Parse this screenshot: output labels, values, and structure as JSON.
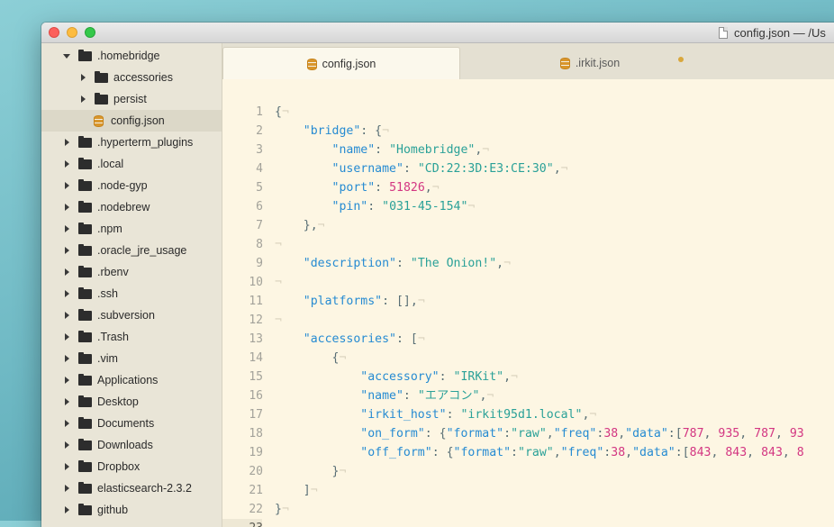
{
  "window": {
    "title": "config.json — /Us"
  },
  "sidebar": {
    "items": [
      {
        "label": ".homebridge",
        "type": "folder",
        "depth": 0,
        "expanded": true
      },
      {
        "label": "accessories",
        "type": "folder",
        "depth": 1,
        "expanded": false
      },
      {
        "label": "persist",
        "type": "folder",
        "depth": 1,
        "expanded": false
      },
      {
        "label": "config.json",
        "type": "file",
        "depth": 1,
        "selected": true
      },
      {
        "label": ".hyperterm_plugins",
        "type": "folder",
        "depth": 0,
        "expanded": false
      },
      {
        "label": ".local",
        "type": "folder",
        "depth": 0,
        "expanded": false
      },
      {
        "label": ".node-gyp",
        "type": "folder",
        "depth": 0,
        "expanded": false
      },
      {
        "label": ".nodebrew",
        "type": "folder",
        "depth": 0,
        "expanded": false
      },
      {
        "label": ".npm",
        "type": "folder",
        "depth": 0,
        "expanded": false
      },
      {
        "label": ".oracle_jre_usage",
        "type": "folder",
        "depth": 0,
        "expanded": false
      },
      {
        "label": ".rbenv",
        "type": "folder",
        "depth": 0,
        "expanded": false
      },
      {
        "label": ".ssh",
        "type": "folder",
        "depth": 0,
        "expanded": false
      },
      {
        "label": ".subversion",
        "type": "folder",
        "depth": 0,
        "expanded": false
      },
      {
        "label": ".Trash",
        "type": "folder",
        "depth": 0,
        "expanded": false
      },
      {
        "label": ".vim",
        "type": "folder",
        "depth": 0,
        "expanded": false
      },
      {
        "label": "Applications",
        "type": "folder",
        "depth": 0,
        "expanded": false
      },
      {
        "label": "Desktop",
        "type": "folder",
        "depth": 0,
        "expanded": false
      },
      {
        "label": "Documents",
        "type": "folder",
        "depth": 0,
        "expanded": false
      },
      {
        "label": "Downloads",
        "type": "folder",
        "depth": 0,
        "expanded": false
      },
      {
        "label": "Dropbox",
        "type": "folder",
        "depth": 0,
        "expanded": false
      },
      {
        "label": "elasticsearch-2.3.2",
        "type": "folder",
        "depth": 0,
        "expanded": false
      },
      {
        "label": "github",
        "type": "folder",
        "depth": 0,
        "expanded": false
      }
    ]
  },
  "tabs": [
    {
      "label": "config.json",
      "active": true,
      "icon": "database-icon"
    },
    {
      "label": ".irkit.json",
      "active": false,
      "icon": "database-icon",
      "dirty": true
    }
  ],
  "editor": {
    "current_line": 23,
    "colors": {
      "key": "#268bd2",
      "string": "#2aa198",
      "number": "#d33682",
      "punct": "#586e75",
      "background": "#fdf6e3"
    },
    "lines": [
      [
        [
          "p",
          "{"
        ]
      ],
      [
        [
          "p",
          "    "
        ],
        [
          "k",
          "\"bridge\""
        ],
        [
          "p",
          ": {"
        ]
      ],
      [
        [
          "p",
          "        "
        ],
        [
          "k",
          "\"name\""
        ],
        [
          "p",
          ": "
        ],
        [
          "s",
          "\"Homebridge\""
        ],
        [
          "p",
          ","
        ]
      ],
      [
        [
          "p",
          "        "
        ],
        [
          "k",
          "\"username\""
        ],
        [
          "p",
          ": "
        ],
        [
          "s",
          "\"CD:22:3D:E3:CE:30\""
        ],
        [
          "p",
          ","
        ]
      ],
      [
        [
          "p",
          "        "
        ],
        [
          "k",
          "\"port\""
        ],
        [
          "p",
          ": "
        ],
        [
          "n",
          "51826"
        ],
        [
          "p",
          ","
        ]
      ],
      [
        [
          "p",
          "        "
        ],
        [
          "k",
          "\"pin\""
        ],
        [
          "p",
          ": "
        ],
        [
          "s",
          "\"031-45-154\""
        ]
      ],
      [
        [
          "p",
          "    },"
        ]
      ],
      [],
      [
        [
          "p",
          "    "
        ],
        [
          "k",
          "\"description\""
        ],
        [
          "p",
          ": "
        ],
        [
          "s",
          "\"The Onion!\""
        ],
        [
          "p",
          ","
        ]
      ],
      [],
      [
        [
          "p",
          "    "
        ],
        [
          "k",
          "\"platforms\""
        ],
        [
          "p",
          ": [],"
        ]
      ],
      [],
      [
        [
          "p",
          "    "
        ],
        [
          "k",
          "\"accessories\""
        ],
        [
          "p",
          ": ["
        ]
      ],
      [
        [
          "p",
          "        {"
        ]
      ],
      [
        [
          "p",
          "            "
        ],
        [
          "k",
          "\"accessory\""
        ],
        [
          "p",
          ": "
        ],
        [
          "s",
          "\"IRKit\""
        ],
        [
          "p",
          ","
        ]
      ],
      [
        [
          "p",
          "            "
        ],
        [
          "k",
          "\"name\""
        ],
        [
          "p",
          ": "
        ],
        [
          "s",
          "\"エアコン\""
        ],
        [
          "p",
          ","
        ]
      ],
      [
        [
          "p",
          "            "
        ],
        [
          "k",
          "\"irkit_host\""
        ],
        [
          "p",
          ": "
        ],
        [
          "s",
          "\"irkit95d1.local\""
        ],
        [
          "p",
          ","
        ]
      ],
      [
        [
          "p",
          "            "
        ],
        [
          "k",
          "\"on_form\""
        ],
        [
          "p",
          ": {"
        ],
        [
          "k",
          "\"format\""
        ],
        [
          "p",
          ":"
        ],
        [
          "s",
          "\"raw\""
        ],
        [
          "p",
          ","
        ],
        [
          "k",
          "\"freq\""
        ],
        [
          "p",
          ":"
        ],
        [
          "n",
          "38"
        ],
        [
          "p",
          ","
        ],
        [
          "k",
          "\"data\""
        ],
        [
          "p",
          ":["
        ],
        [
          "n",
          "787"
        ],
        [
          "p",
          ", "
        ],
        [
          "n",
          "935"
        ],
        [
          "p",
          ", "
        ],
        [
          "n",
          "787"
        ],
        [
          "p",
          ", "
        ],
        [
          "n",
          "93"
        ]
      ],
      [
        [
          "p",
          "            "
        ],
        [
          "k",
          "\"off_form\""
        ],
        [
          "p",
          ": {"
        ],
        [
          "k",
          "\"format\""
        ],
        [
          "p",
          ":"
        ],
        [
          "s",
          "\"raw\""
        ],
        [
          "p",
          ","
        ],
        [
          "k",
          "\"freq\""
        ],
        [
          "p",
          ":"
        ],
        [
          "n",
          "38"
        ],
        [
          "p",
          ","
        ],
        [
          "k",
          "\"data\""
        ],
        [
          "p",
          ":["
        ],
        [
          "n",
          "843"
        ],
        [
          "p",
          ", "
        ],
        [
          "n",
          "843"
        ],
        [
          "p",
          ", "
        ],
        [
          "n",
          "843"
        ],
        [
          "p",
          ", "
        ],
        [
          "n",
          "8"
        ]
      ],
      [
        [
          "p",
          "        }"
        ]
      ],
      [
        [
          "p",
          "    ]"
        ]
      ],
      [
        [
          "p",
          "}"
        ]
      ],
      []
    ],
    "eol_marker": "¬"
  }
}
